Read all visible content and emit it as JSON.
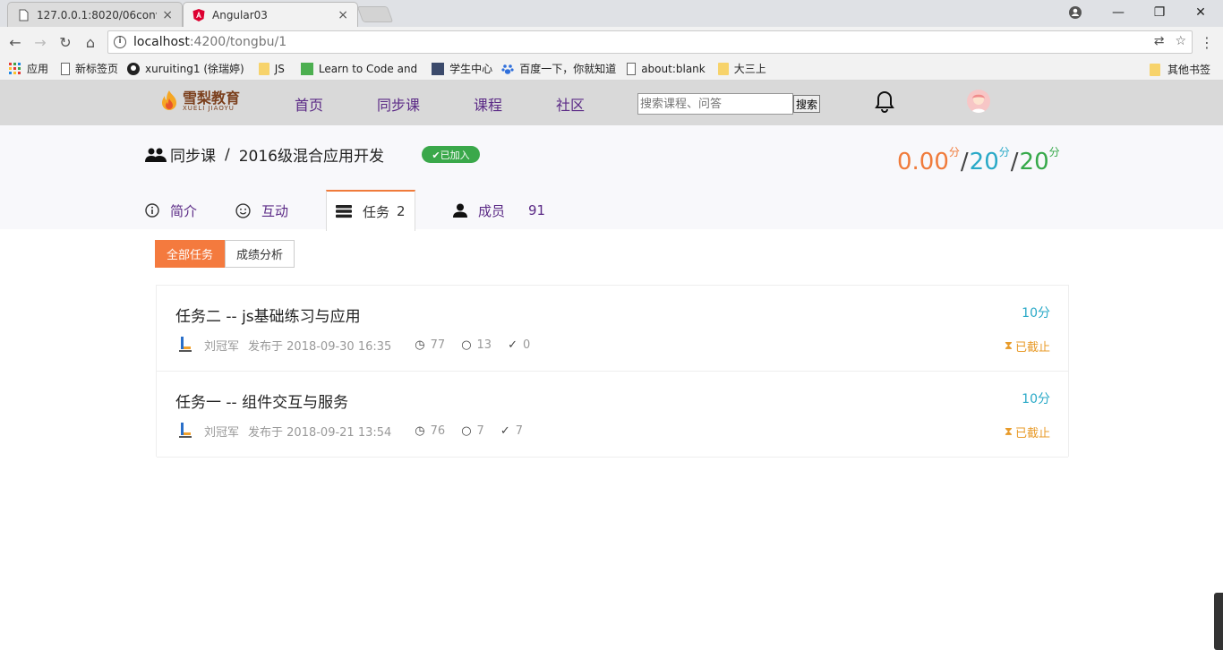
{
  "browser": {
    "tabs": [
      {
        "title": "127.0.0.1:8020/06conv",
        "close": "×"
      },
      {
        "title": "Angular03",
        "close": "×"
      }
    ],
    "window": {
      "minimize": "—",
      "restore": "❐",
      "close": "✕"
    },
    "url_host": "localhost",
    "url_path": ":4200/tongbu/1",
    "bookmarks": [
      "应用",
      "新标签页",
      "xuruiting1 (徐瑞婷)",
      "JS",
      "Learn to Code and",
      "学生中心",
      "百度一下，你就知道",
      "about:blank",
      "大三上"
    ],
    "other_bookmarks": "其他书签"
  },
  "site": {
    "logo_cn": "雪梨教育",
    "logo_en": "XUELI JIAOYU",
    "nav": [
      "首页",
      "同步课",
      "课程",
      "社区"
    ],
    "search_placeholder": "搜索课程、问答",
    "search_button": "搜索"
  },
  "course": {
    "breadcrumb_root": "同步课",
    "breadcrumb_sep": "/",
    "title": "2016级混合应用开发",
    "joined_badge": "✔已加入",
    "score": {
      "earned": "0.00",
      "earned_unit": "分",
      "total1": "20",
      "total1_unit": "分",
      "total2": "20",
      "total2_unit": "分",
      "slash": "/"
    },
    "tabs": [
      {
        "label": "简介",
        "count": ""
      },
      {
        "label": "互动",
        "count": ""
      },
      {
        "label": "任务",
        "count": "2"
      },
      {
        "label": "成员",
        "count": "91"
      }
    ]
  },
  "filters": [
    "全部任务",
    "成绩分析"
  ],
  "tasks": [
    {
      "title": "任务二 -- js基础练习与应用",
      "author": "刘冠军",
      "published": "发布于 2018-09-30 16:35",
      "views": "77",
      "comments": "13",
      "done": "0",
      "points": "10分",
      "status": "已截止"
    },
    {
      "title": "任务一 -- 组件交互与服务",
      "author": "刘冠军",
      "published": "发布于 2018-09-21 13:54",
      "views": "76",
      "comments": "7",
      "done": "7",
      "points": "10分",
      "status": "已截止"
    }
  ],
  "colors": {
    "accent": "#f47a3e",
    "nav_text": "#5b2a86",
    "blue": "#29a9c7",
    "green": "#36a94a",
    "joined": "#3aa84a"
  }
}
